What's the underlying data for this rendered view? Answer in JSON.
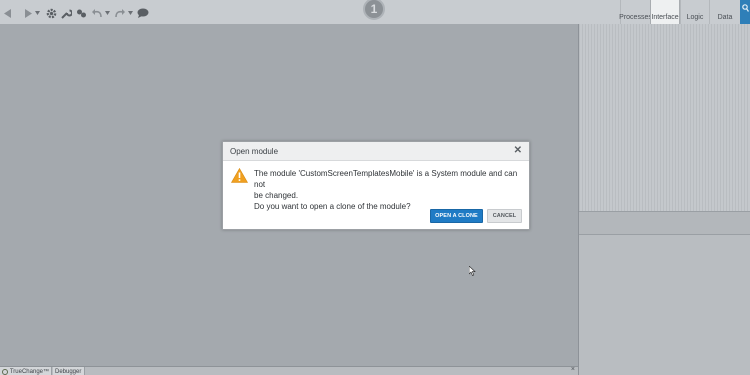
{
  "toolbar": {
    "buttons": [
      {
        "name": "back",
        "icon": "arrow-left-icon"
      },
      {
        "name": "forward",
        "icon": "arrow-right-icon"
      },
      {
        "name": "forward-dropdown",
        "icon": "chevron-down-icon"
      },
      {
        "name": "settings",
        "icon": "gear-icon"
      },
      {
        "name": "tools",
        "icon": "wrench-icon"
      },
      {
        "name": "plugins",
        "icon": "puzzle-icon"
      },
      {
        "name": "undo",
        "icon": "undo-icon"
      },
      {
        "name": "undo-dropdown",
        "icon": "chevron-down-icon"
      },
      {
        "name": "redo",
        "icon": "redo-icon"
      },
      {
        "name": "redo-dropdown",
        "icon": "chevron-down-icon"
      },
      {
        "name": "chat",
        "icon": "speech-bubble-icon"
      }
    ],
    "center_badge": "1"
  },
  "tabs": [
    {
      "label": "Processes",
      "active": false
    },
    {
      "label": "Interface",
      "active": true
    },
    {
      "label": "Logic",
      "active": false
    },
    {
      "label": "Data",
      "active": false
    }
  ],
  "search_icon": "search-icon",
  "modal": {
    "title": "Open module",
    "close_symbol": "✕",
    "icon": "warning-icon",
    "message_line1": "The module 'CustomScreenTemplatesMobile' is a System module and can not",
    "message_line2": "be changed.",
    "message_line3": "Do you want to open a clone of the module?",
    "primary_button": "OPEN A CLONE",
    "secondary_button": "CANCEL"
  },
  "bottom_bar": {
    "tabs": [
      "TrueChange™",
      "Debugger"
    ],
    "close_symbol": "×"
  },
  "colors": {
    "accent": "#1f7bc5",
    "warning": "#f0a020",
    "workspace": "#a4a9ae"
  }
}
